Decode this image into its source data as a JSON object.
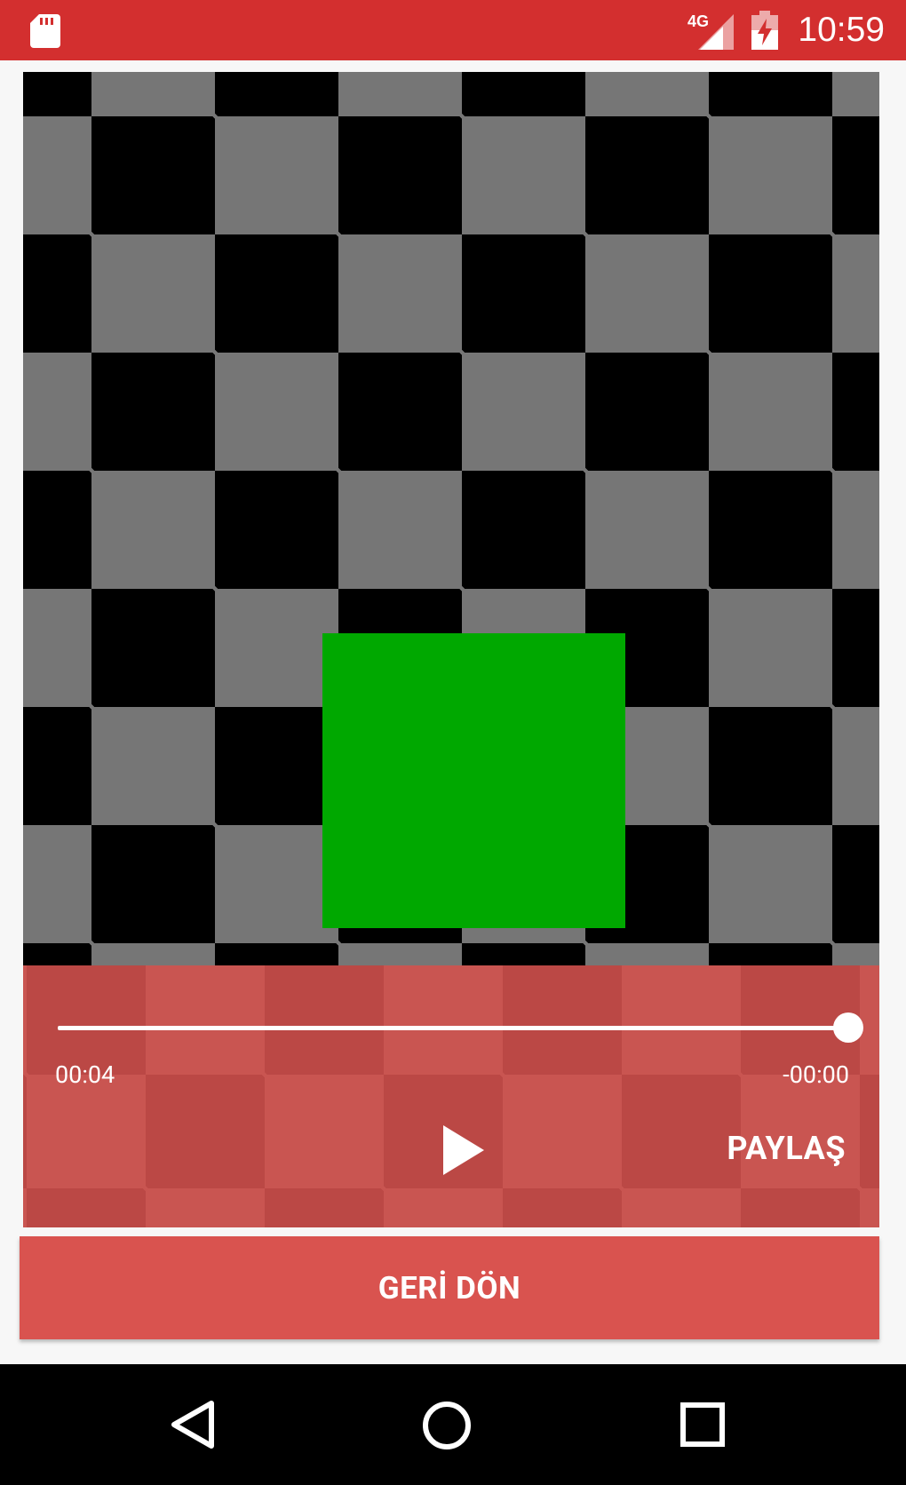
{
  "status_bar": {
    "time": "10:59",
    "network_label": "4G",
    "icons": [
      "sd-card-icon",
      "signal-4g-icon",
      "battery-charging-icon"
    ],
    "color": "#d32f2f"
  },
  "video": {
    "checker_colors": [
      "#000000",
      "#767676"
    ],
    "square_color": "#00a800"
  },
  "player": {
    "current_time": "00:04",
    "remaining_time": "-00:00",
    "progress": 1.0,
    "play_icon": "play-icon",
    "share_label": "PAYLAŞ"
  },
  "back_button": {
    "label": "GERİ DÖN",
    "color": "#d9534f"
  },
  "nav_bar": {
    "icons": [
      "nav-back-icon",
      "nav-home-icon",
      "nav-recent-icon"
    ]
  }
}
